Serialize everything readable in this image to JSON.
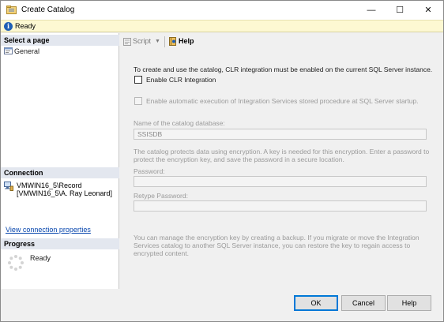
{
  "window": {
    "title": "Create Catalog",
    "controls": {
      "minimize": "—",
      "maximize": "☐",
      "close": "✕"
    }
  },
  "status": {
    "text": "Ready",
    "icon": "info-icon"
  },
  "left_panel": {
    "select_page_header": "Select a page",
    "pages": [
      {
        "label": "General",
        "icon": "page-icon"
      }
    ],
    "connection_header": "Connection",
    "connection": {
      "server": "VMWIN16_5\\Record",
      "user": "[VMWIN16_5\\A. Ray Leonard]",
      "icon": "server-connection-icon"
    },
    "view_link": "View connection properties",
    "progress_header": "Progress",
    "progress_status": "Ready"
  },
  "toolbar": {
    "script_label": "Script",
    "help_label": "Help"
  },
  "form": {
    "clr_note": "To create and use the catalog, CLR integration must be enabled on the current SQL Server instance.",
    "enable_clr_label": "Enable CLR Integration",
    "enable_clr_checked": false,
    "auto_exec_label": "Enable automatic execution of Integration Services stored procedure at SQL Server startup.",
    "auto_exec_checked": false,
    "catalog_name_label": "Name of the catalog database:",
    "catalog_name_value": "SSISDB",
    "encryption_note_line1": "The catalog protects data using encryption. A key is needed for this encryption. Enter a password to",
    "encryption_note_line2": "protect the encryption key, and save the password in a secure location.",
    "password_label": "Password:",
    "password_value": "",
    "retype_label": "Retype Password:",
    "retype_value": "",
    "backup_note_line1": "You can manage the encryption key by creating a backup. If you migrate or move the Integration",
    "backup_note_line2": "Services catalog to another SQL Server instance, you can restore the key to regain access to",
    "backup_note_line3": "encrypted content."
  },
  "buttons": {
    "ok": "OK",
    "cancel": "Cancel",
    "help": "Help"
  },
  "colors": {
    "accent": "#0078d7",
    "status_bar": "#fdf8d2",
    "section_header": "#e3e7ef",
    "link": "#0645ad"
  }
}
